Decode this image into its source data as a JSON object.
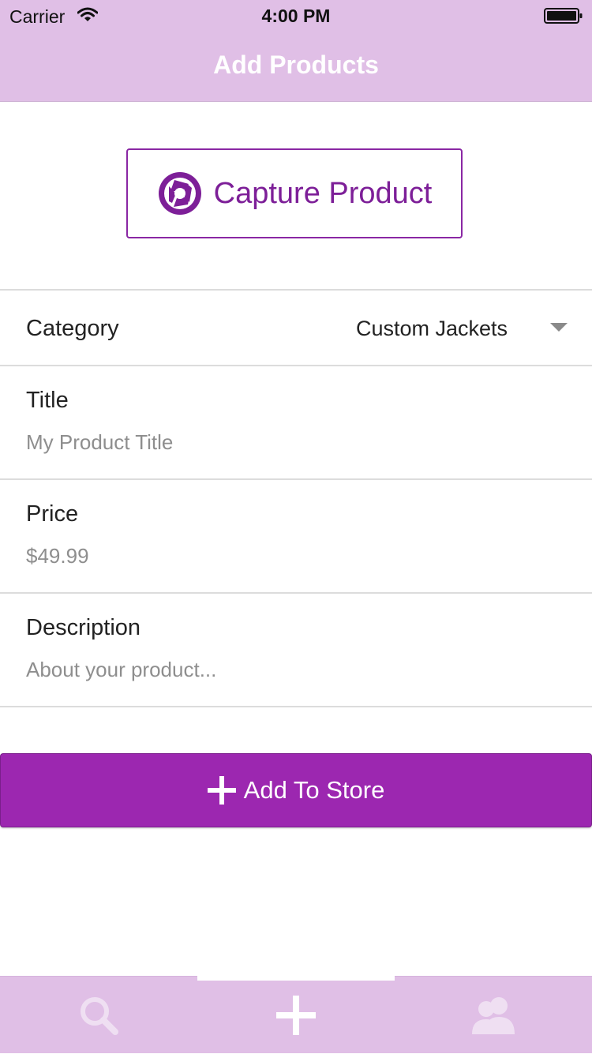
{
  "status_bar": {
    "carrier": "Carrier",
    "time": "4:00 PM"
  },
  "nav": {
    "title": "Add Products"
  },
  "capture": {
    "label": "Capture Product",
    "icon": "aperture-icon"
  },
  "form": {
    "category": {
      "label": "Category",
      "value": "Custom Jackets"
    },
    "title": {
      "label": "Title",
      "placeholder": "My Product Title"
    },
    "price": {
      "label": "Price",
      "value": "$49.99"
    },
    "description": {
      "label": "Description",
      "placeholder": "About your product..."
    }
  },
  "add_button": {
    "label": "Add To Store",
    "icon": "plus-icon"
  },
  "tabs": [
    {
      "name": "search",
      "icon": "search-icon",
      "active": false
    },
    {
      "name": "add",
      "icon": "plus-icon",
      "active": true
    },
    {
      "name": "users",
      "icon": "users-icon",
      "active": false
    }
  ],
  "colors": {
    "header": "#e0bfe6",
    "accent": "#9c27b0",
    "accent_dark": "#7d1f98",
    "tab_icon": "#ffffff"
  }
}
